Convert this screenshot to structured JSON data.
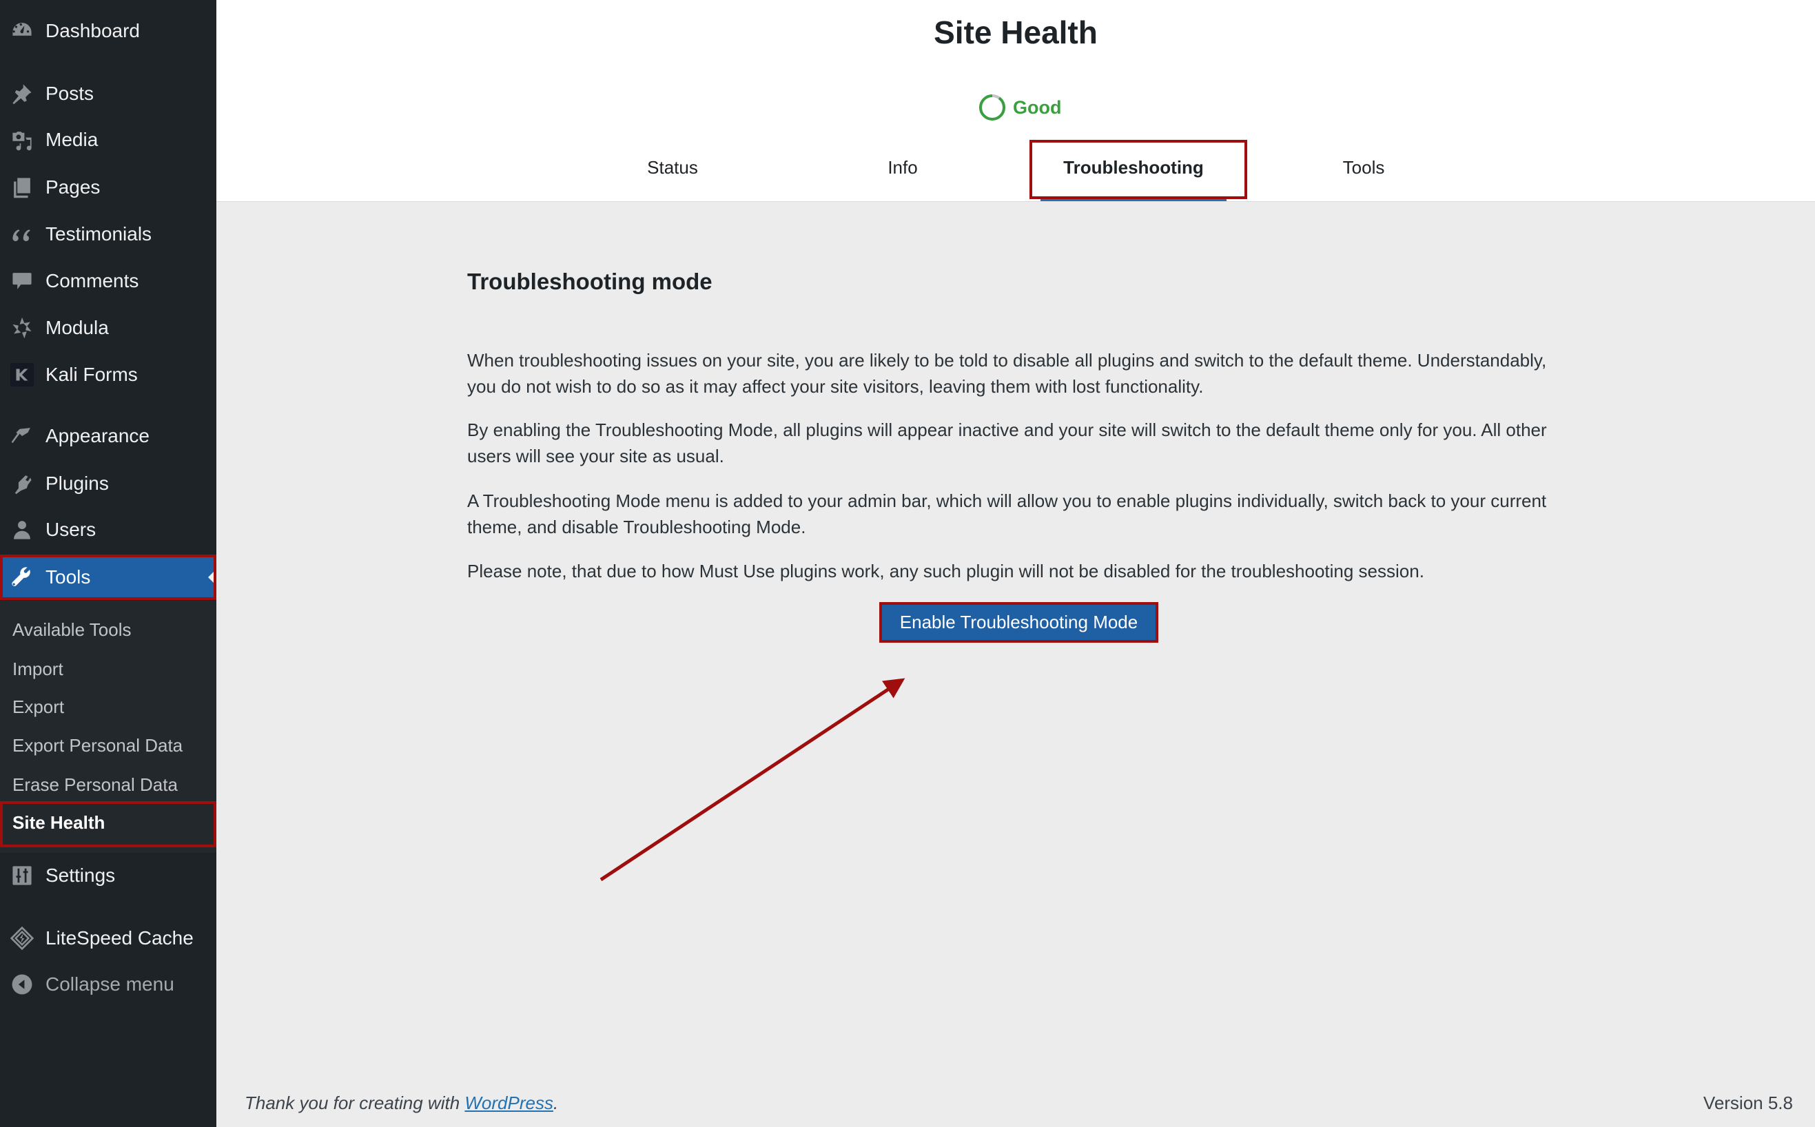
{
  "sidebar": {
    "items": [
      {
        "label": "Dashboard",
        "icon": "dashboard-icon"
      },
      {
        "label": "Posts",
        "icon": "pin-icon"
      },
      {
        "label": "Media",
        "icon": "media-icon"
      },
      {
        "label": "Pages",
        "icon": "pages-icon"
      },
      {
        "label": "Testimonials",
        "icon": "quote-icon"
      },
      {
        "label": "Comments",
        "icon": "comment-icon"
      },
      {
        "label": "Modula",
        "icon": "modula-icon"
      },
      {
        "label": "Kali Forms",
        "icon": "kali-forms-icon"
      },
      {
        "label": "Appearance",
        "icon": "paintbrush-icon"
      },
      {
        "label": "Plugins",
        "icon": "plugin-icon"
      },
      {
        "label": "Users",
        "icon": "user-icon"
      },
      {
        "label": "Tools",
        "icon": "wrench-icon",
        "active": true
      },
      {
        "label": "Settings",
        "icon": "settings-icon"
      },
      {
        "label": "LiteSpeed Cache",
        "icon": "litespeed-icon"
      }
    ],
    "tools_submenu": [
      {
        "label": "Available Tools"
      },
      {
        "label": "Import"
      },
      {
        "label": "Export"
      },
      {
        "label": "Export Personal Data"
      },
      {
        "label": "Erase Personal Data"
      },
      {
        "label": "Site Health",
        "current": true
      }
    ],
    "collapse_label": "Collapse menu"
  },
  "header": {
    "title": "Site Health",
    "status_label": "Good",
    "status_color": "#3a9f3f",
    "status_progress_fraction": 0.9,
    "tabs": [
      {
        "label": "Status"
      },
      {
        "label": "Info"
      },
      {
        "label": "Troubleshooting",
        "active": true
      },
      {
        "label": "Tools"
      }
    ]
  },
  "main": {
    "heading": "Troubleshooting mode",
    "paragraphs": [
      "When troubleshooting issues on your site, you are likely to be told to disable all plugins and switch to the default theme. Understandably, you do not wish to do so as it may affect your site visitors, leaving them with lost functionality.",
      "By enabling the Troubleshooting Mode, all plugins will appear inactive and your site will switch to the default theme only for you. All other users will see your site as usual.",
      "A Troubleshooting Mode menu is added to your admin bar, which will allow you to enable plugins individually, switch back to your current theme, and disable Troubleshooting Mode.",
      "Please note, that due to how Must Use plugins work, any such plugin will not be disabled for the troubleshooting session."
    ],
    "button_label": "Enable Troubleshooting Mode"
  },
  "footer": {
    "thanks_prefix": "Thank you for creating with ",
    "link_label": "WordPress",
    "thanks_suffix": ".",
    "version": "Version 5.8"
  },
  "colors": {
    "sidebar_bg": "#1d2327",
    "accent": "#1f5fa3",
    "annotation": "#a00d0d"
  }
}
